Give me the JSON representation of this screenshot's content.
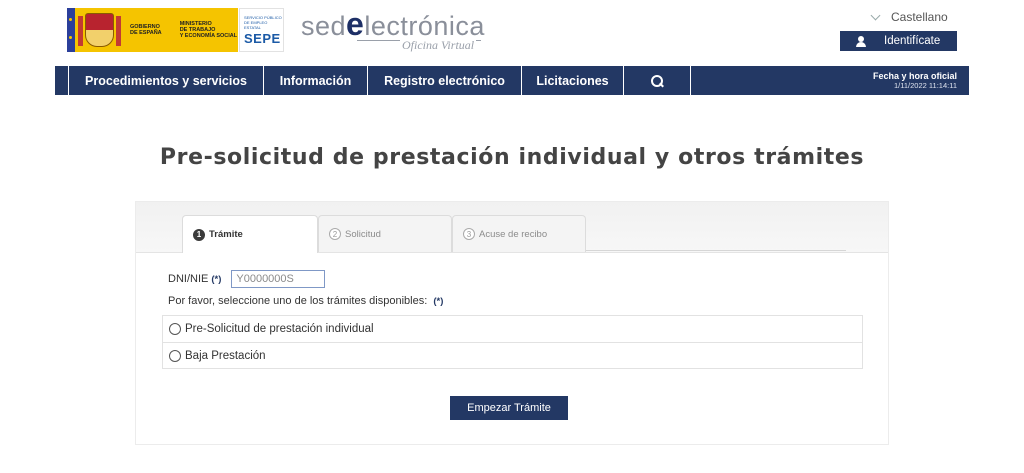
{
  "header": {
    "gov_logo": {
      "line1": "GOBIERNO",
      "line2": "DE ESPAÑA",
      "ministry_line1": "MINISTERIO",
      "ministry_line2": "DE TRABAJO",
      "ministry_line3": "Y ECONOMÍA SOCIAL"
    },
    "sepe_logo": {
      "small_line1": "SERVICIO PÚBLICO",
      "small_line2": "DE EMPLEO ESTATAL",
      "big": "SEPE"
    },
    "sede_logo": {
      "pre": "sed",
      "e": "e",
      "post": "lectrónica",
      "subtitle": "Oficina Virtual"
    },
    "language": "Castellano",
    "login_label": "Identifícate"
  },
  "nav": {
    "items": [
      {
        "label": "Procedimientos y servicios"
      },
      {
        "label": "Información"
      },
      {
        "label": "Registro electrónico"
      },
      {
        "label": "Licitaciones"
      }
    ],
    "date_label": "Fecha y hora oficial",
    "date_value": "1/11/2022 11:14:11"
  },
  "page": {
    "title": "Pre-solicitud de prestación individual y otros trámites"
  },
  "tabs": [
    {
      "num": "1",
      "label": "Trámite",
      "active": true
    },
    {
      "num": "2",
      "label": "Solicitud",
      "active": false
    },
    {
      "num": "3",
      "label": "Acuse de recibo",
      "active": false
    }
  ],
  "form": {
    "dni_label": "DNI/NIE",
    "required_mark": "(*)",
    "dni_placeholder": "Y0000000S",
    "dni_value": "",
    "help_text": "Por favor, seleccione uno de los trámites disponibles:",
    "options": [
      {
        "label": "Pre-Solicitud de prestación individual"
      },
      {
        "label": "Baja Prestación"
      }
    ],
    "submit_label": "Empezar Trámite"
  },
  "colors": {
    "brand_navy": "#233864",
    "gov_yellow": "#f5c400"
  }
}
